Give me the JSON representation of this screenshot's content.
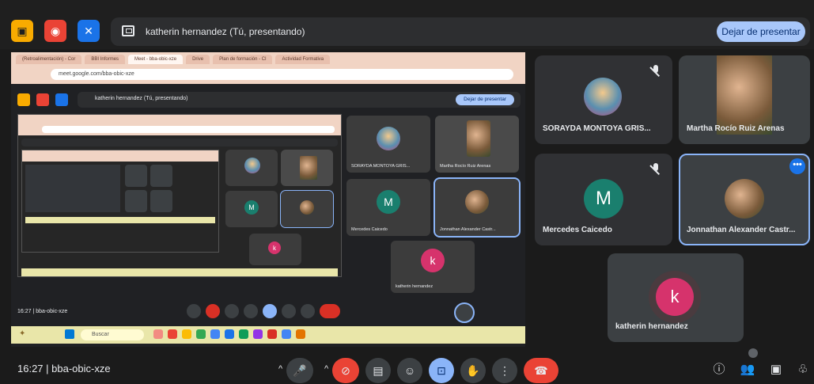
{
  "topbar": {
    "presenter_banner": "katherin hernandez (Tú, presentando)",
    "stop_button": "Dejar de presentar",
    "colors": {
      "yellow": "#f9ab00",
      "red": "#ea4335",
      "blue": "#1a73e8"
    }
  },
  "presented_browser": {
    "tabs": [
      "(Retroalimentación) - Cor",
      "BBI Informes",
      "Meet - bba-obic-xze",
      "Drive",
      "Plan de formación - Cl",
      "Actividad Formativa"
    ],
    "url": "meet.google.com/bba-obic-xze",
    "nested_banner": "katherin hernandez (Tú, presentando)",
    "nested_stop": "Dejar de presentar",
    "nested_time": "16:27  |  bba-obic-xze",
    "tiles": [
      {
        "name": "SORAYDA MONTOYA GRIS...",
        "avatar": "group"
      },
      {
        "name": "Martha Rocío Ruiz Arenas",
        "avatar": "photo"
      },
      {
        "name": "Mercedes Caicedo",
        "avatar": "M"
      },
      {
        "name": "Jonnathan Alexander Castr...",
        "avatar": "photo"
      },
      {
        "name": "katherin hernandez",
        "avatar": "k"
      }
    ],
    "taskbar_search": "Buscar"
  },
  "participants": [
    {
      "name": "SORAYDA MONTOYA GRIS...",
      "avatar_letter": "",
      "muted": true
    },
    {
      "name": "Martha Rocío Ruiz Arenas",
      "avatar_letter": "",
      "muted": false
    },
    {
      "name": "Mercedes Caicedo",
      "avatar_letter": "M",
      "muted": true
    },
    {
      "name": "Jonnathan Alexander Castr...",
      "avatar_letter": "",
      "muted": false,
      "more": "•••"
    },
    {
      "name": "katherin hernandez",
      "avatar_letter": "k",
      "muted": false
    }
  ],
  "bottombar": {
    "time_code": "16:27  |  bba-obic-xze",
    "controls": [
      "mic",
      "camera-off",
      "captions",
      "emoji",
      "present",
      "raise-hand",
      "more",
      "leave"
    ],
    "right_icons": [
      "info",
      "people",
      "chat",
      "activities"
    ]
  }
}
